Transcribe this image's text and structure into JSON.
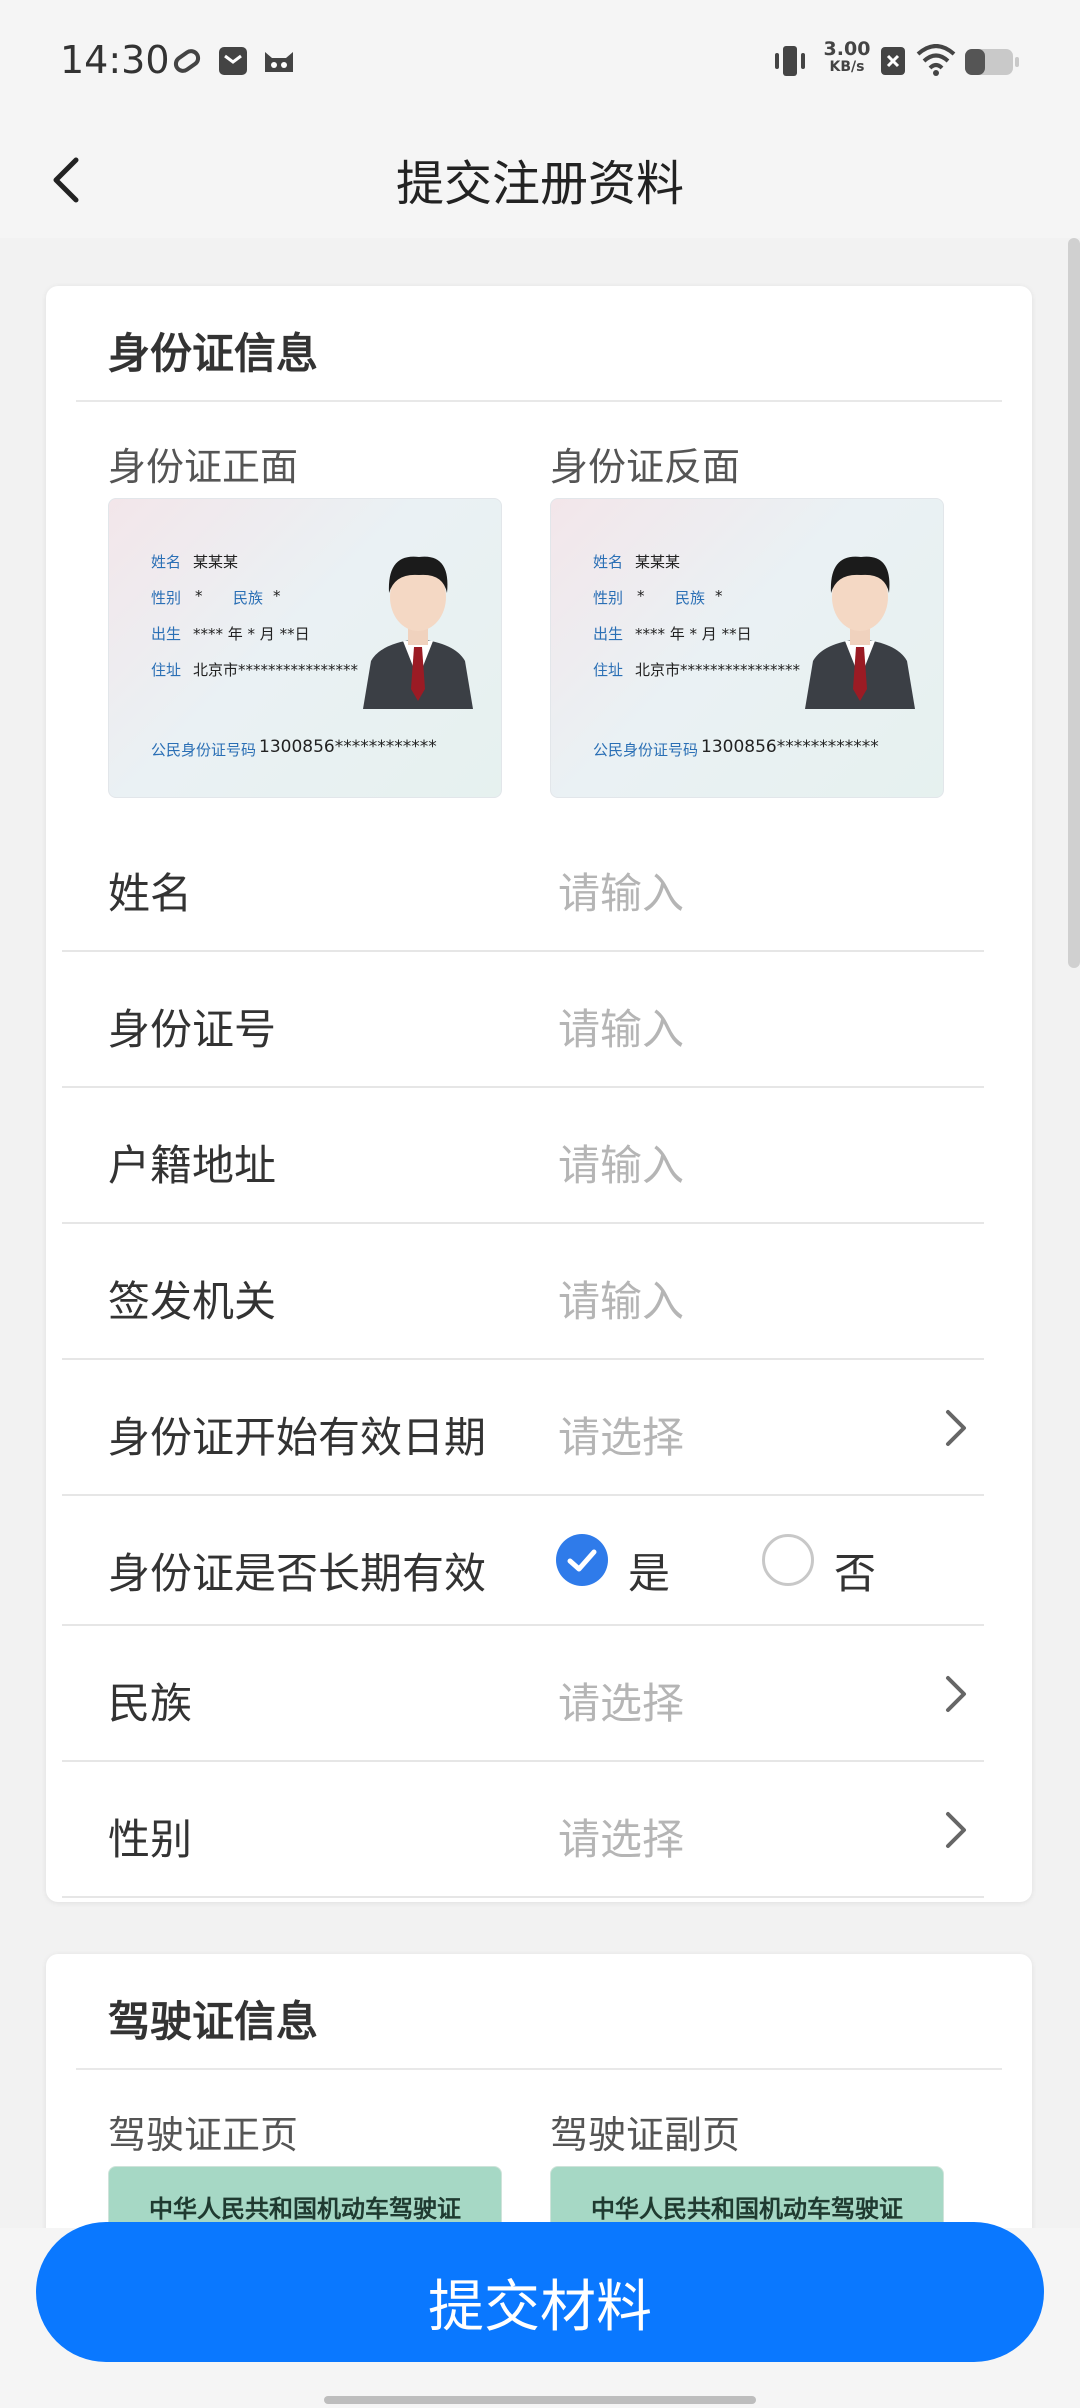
{
  "status_bar": {
    "time": "14:30",
    "net_speed": "3.00",
    "net_unit": "KB/s",
    "icons": [
      "link-icon",
      "mail-icon",
      "cat-icon",
      "vibrate-icon",
      "sim-off-icon",
      "wifi-icon",
      "battery-icon"
    ]
  },
  "app_bar": {
    "title": "提交注册资料",
    "back_icon": "chevron-left-icon"
  },
  "id_section": {
    "title": "身份证信息",
    "front_label": "身份证正面",
    "back_label": "身份证反面",
    "card": {
      "name_key": "姓名",
      "name_val": "某某某",
      "gender_key": "性别",
      "gender_val": "*",
      "ethnic_key": "民族",
      "ethnic_val": "*",
      "birth_key": "出生",
      "birth_val": "**** 年 * 月 **日",
      "address_key": "住址",
      "address_val": "北京市****************",
      "idno_key": "公民身份证号码",
      "idno_val": "1300856************"
    },
    "fields": [
      {
        "label": "姓名",
        "placeholder": "请输入"
      },
      {
        "label": "身份证号",
        "placeholder": "请输入"
      },
      {
        "label": "户籍地址",
        "placeholder": "请输入"
      },
      {
        "label": "签发机关",
        "placeholder": "请输入"
      },
      {
        "label": "身份证开始有效日期",
        "placeholder": "请选择"
      },
      {
        "label": "身份证是否长期有效",
        "yes": "是",
        "no": "否",
        "selected": "是"
      },
      {
        "label": "民族",
        "placeholder": "请选择"
      },
      {
        "label": "性别",
        "placeholder": "请选择"
      }
    ]
  },
  "license_section": {
    "title": "驾驶证信息",
    "front_label": "驾驶证正页",
    "back_label": "驾驶证副页",
    "card_title": "中华人民共和国机动车驾驶证"
  },
  "submit": {
    "label": "提交材料"
  },
  "colors": {
    "accent": "#0a78ff",
    "radio_checked": "#2f7bea",
    "placeholder": "#b5b5b5"
  }
}
